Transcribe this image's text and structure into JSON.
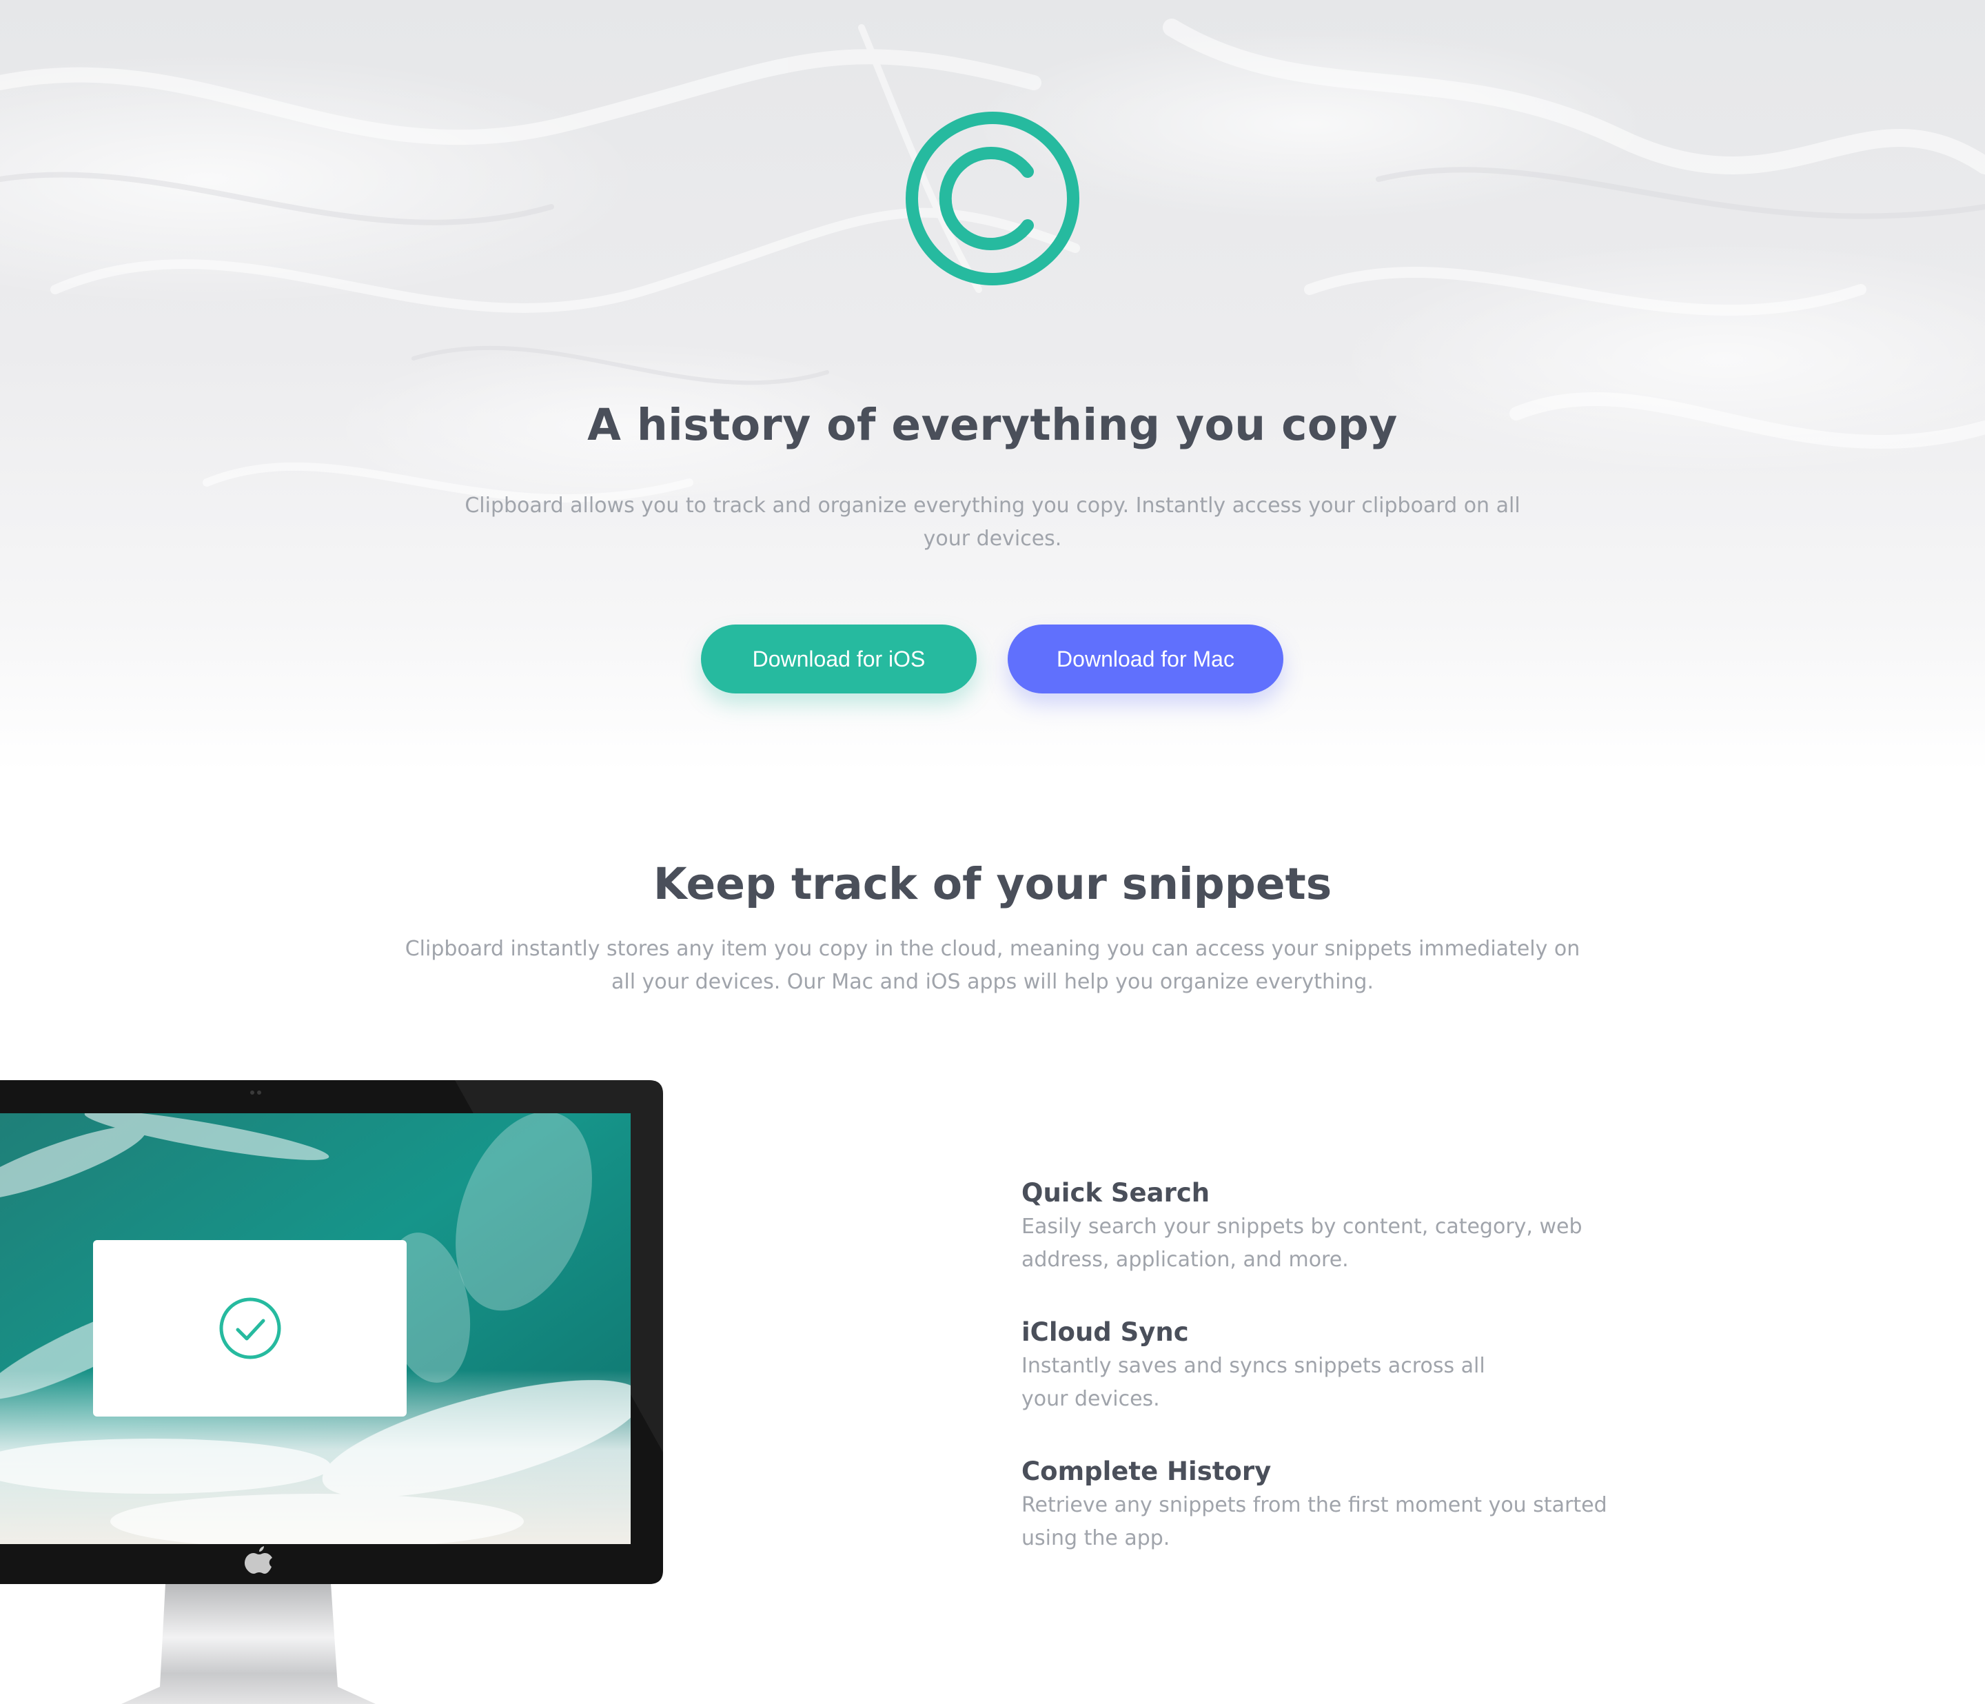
{
  "hero": {
    "logo_icon": "copyright-c-icon",
    "title": "A history of everything you copy",
    "description": "Clipboard allows you to track and organize everything you copy. Instantly access your clipboard on all your devices.",
    "buttons": {
      "ios": "Download for iOS",
      "mac": "Download for Mac"
    }
  },
  "snippets": {
    "title": "Keep track of your snippets",
    "description": "Clipboard instantly stores any item you copy in the cloud, meaning you can access your snippets immediately on all your devices. Our Mac and iOS apps will help you organize everything."
  },
  "features": [
    {
      "title": "Quick Search",
      "description": "Easily search your snippets by content, category, web address, application, and more."
    },
    {
      "title": "iCloud Sync",
      "description": "Instantly saves and syncs snippets across all your devices."
    },
    {
      "title": "Complete History",
      "description": "Retrieve any snippets from the first moment you started using the app."
    }
  ],
  "colors": {
    "accent_green": "#26ba9f",
    "accent_blue": "#6070fd",
    "heading": "#4a4f5a",
    "body_text": "#a0a4ab"
  },
  "illustration": {
    "monitor_icon": "imac-monitor-icon",
    "check_icon": "checkmark-circle-icon",
    "apple_icon": "apple-logo-icon"
  }
}
